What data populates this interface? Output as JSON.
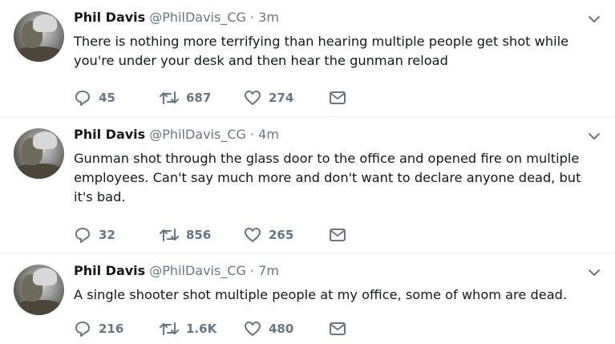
{
  "tweets": [
    {
      "name": "Phil Davis",
      "handle": "@PhilDavis_CG",
      "separator": "·",
      "time": "3m",
      "text": "There is nothing more terrifying than hearing multiple people get shot while you're under your desk and then hear the gunman reload",
      "replies": "45",
      "retweets": "687",
      "likes": "274"
    },
    {
      "name": "Phil Davis",
      "handle": "@PhilDavis_CG",
      "separator": "·",
      "time": "4m",
      "text": "Gunman shot through the glass door to the office and opened fire on multiple employees. Can't say much more and don't want to declare anyone dead, but it's bad.",
      "replies": "32",
      "retweets": "856",
      "likes": "265"
    },
    {
      "name": "Phil Davis",
      "handle": "@PhilDavis_CG",
      "separator": "·",
      "time": "7m",
      "text": "A single shooter shot multiple people at my office, some of whom are dead.",
      "replies": "216",
      "retweets": "1.6K",
      "likes": "480"
    }
  ],
  "icons": {
    "reply": "reply-icon",
    "retweet": "retweet-icon",
    "like": "heart-icon",
    "message": "envelope-icon",
    "more": "chevron-down-icon"
  },
  "colors": {
    "text": "#14171a",
    "secondary": "#657786",
    "divider": "#e6ecf0"
  }
}
